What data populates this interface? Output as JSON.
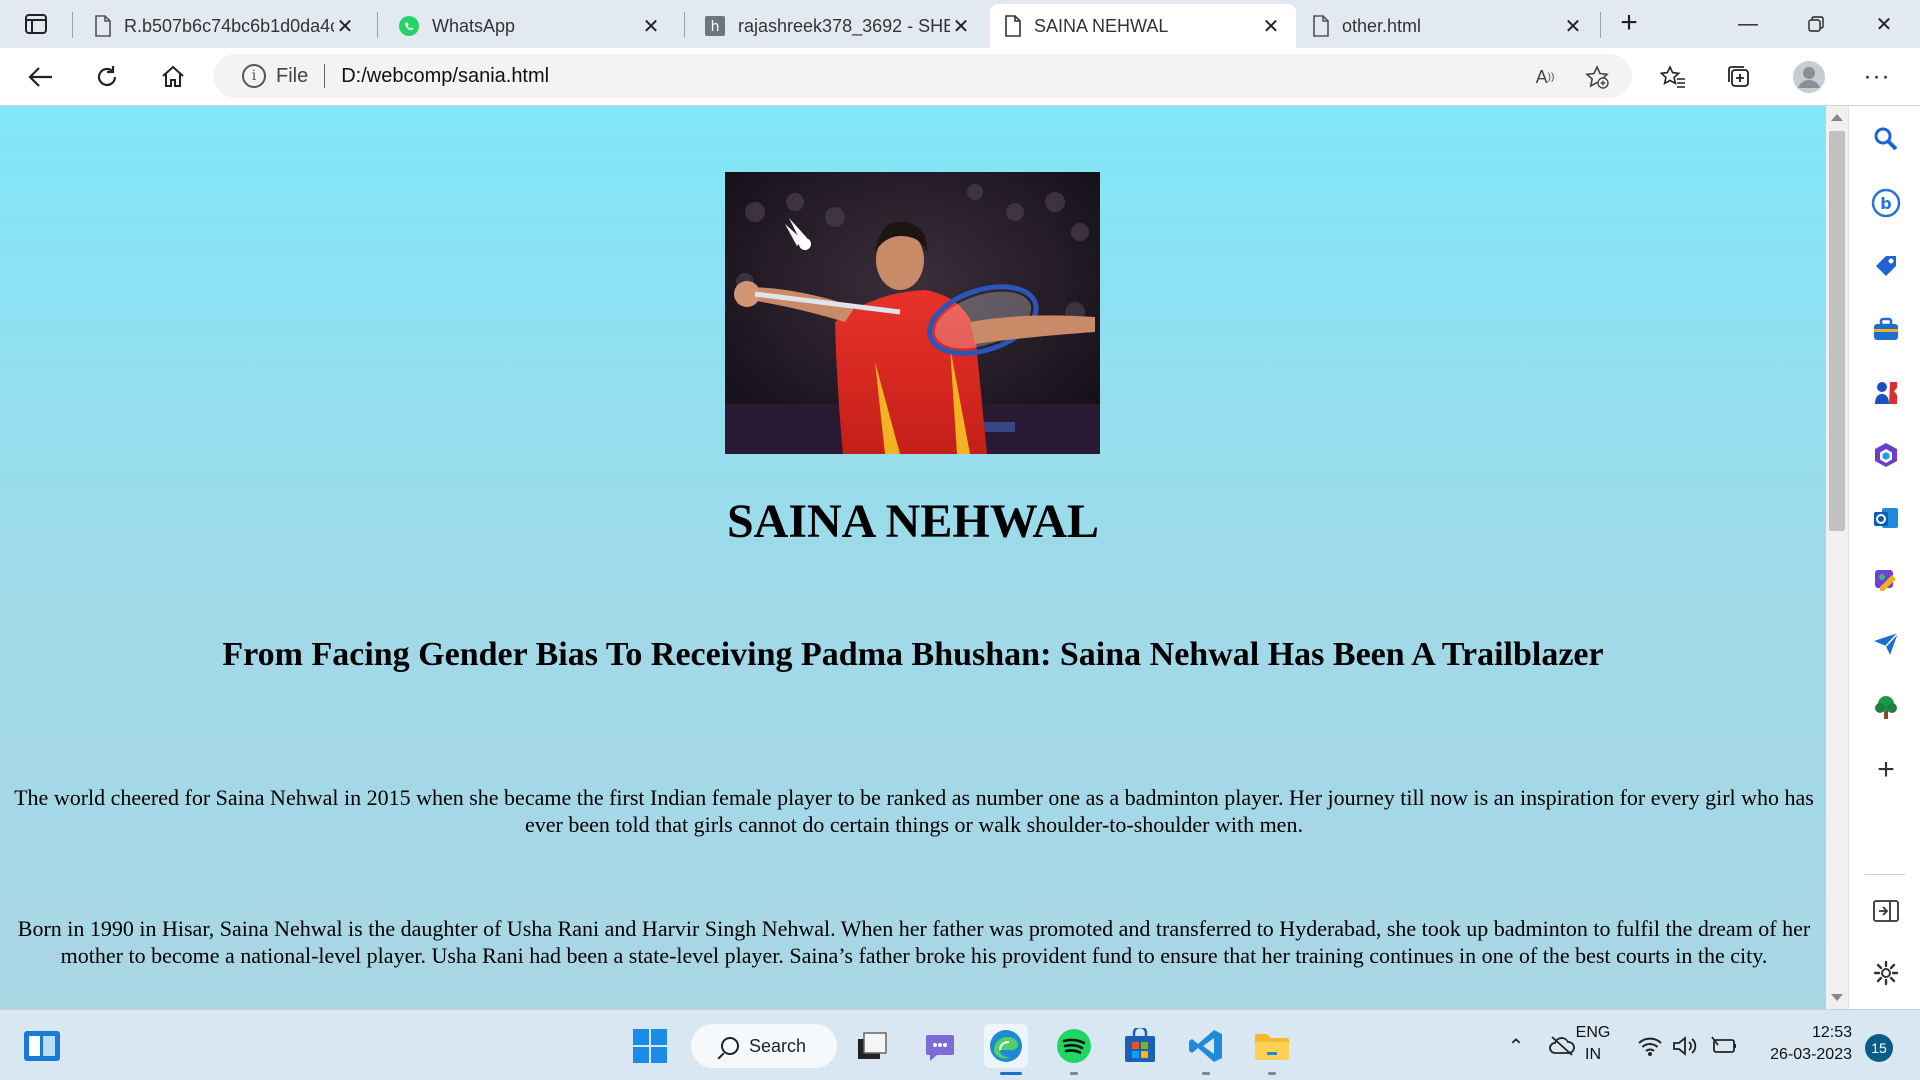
{
  "browser": {
    "tabs": [
      {
        "title": "R.b507b6c74bc6b1d0da4c",
        "icon": "page-icon",
        "active": false
      },
      {
        "title": "WhatsApp",
        "icon": "whatsapp-icon",
        "active": false
      },
      {
        "title": "rajashreek378_3692 - SHE",
        "icon": "hackerrank-icon",
        "active": false
      },
      {
        "title": "SAINA NEHWAL",
        "icon": "page-icon",
        "active": true
      },
      {
        "title": "other.html",
        "icon": "page-icon",
        "active": false
      }
    ],
    "address": {
      "scheme_label": "File",
      "url": "D:/webcomp/sania.html"
    }
  },
  "page": {
    "title": "SAINA NEHWAL",
    "subtitle": "From Facing Gender Bias To Receiving Padma Bhushan: Saina Nehwal Has Been A Trailblazer",
    "paragraphs": [
      "The world cheered for Saina Nehwal in 2015 when she became the first Indian female player to be ranked as number one as a badminton player. Her journey till now is an inspiration for every girl who has ever been told that girls cannot do certain things or walk shoulder-to-shoulder with men.",
      "Born in 1990 in Hisar, Saina Nehwal is the daughter of Usha Rani and Harvir Singh Nehwal. When her father was promoted and transferred to Hyderabad, she took up badminton to fulfil the dream of her mother to become a national-level player. Usha Rani had been a state-level player. Saina’s father broke his provident fund to ensure that her training continues in one of the best courts in the city."
    ],
    "hero_image": "badminton-player-photo"
  },
  "taskbar": {
    "search_label": "Search",
    "language": {
      "line1": "ENG",
      "line2": "IN"
    },
    "clock": {
      "time": "12:53",
      "date": "26-03-2023"
    },
    "notification_count": "15"
  },
  "colors": {
    "page_gradient_top": "#80e6f8",
    "page_gradient_bottom": "#aad6e4",
    "tabstrip": "#e3e9f0",
    "taskbar": "#d8e7f1"
  }
}
